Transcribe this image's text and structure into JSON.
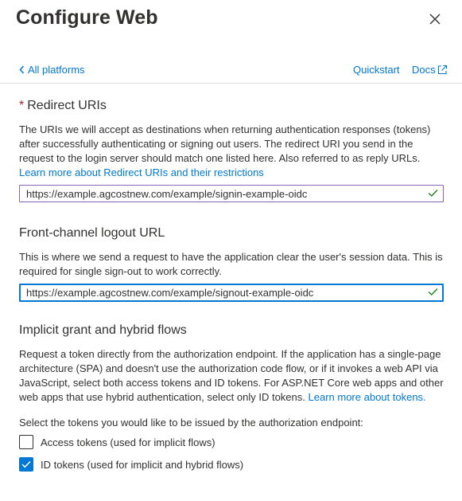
{
  "panel": {
    "title": "Configure Web",
    "close_icon": "close-icon"
  },
  "nav": {
    "back_label": "All platforms",
    "quickstart_label": "Quickstart",
    "docs_label": "Docs"
  },
  "redirect": {
    "required_marker": "*",
    "heading": "Redirect URIs",
    "description": "The URIs we will accept as destinations when returning authentication responses (tokens) after successfully authenticating or signing out users. The redirect URI you send in the request to the login server should match one listed here. Also referred to as reply URLs.",
    "learn_more": "Learn more about Redirect URIs and their restrictions",
    "uri_value": "https://example.agcostnew.com/example/signin-example-oidc"
  },
  "logout": {
    "heading": "Front-channel logout URL",
    "description": "This is where we send a request to have the application clear the user's session data. This is required for single sign-out to work correctly.",
    "url_value": "https://example.agcostnew.com/example/signout-example-oidc"
  },
  "implicit": {
    "heading": "Implicit grant and hybrid flows",
    "description": "Request a token directly from the authorization endpoint. If the application has a single-page architecture (SPA) and doesn't use the authorization code flow, or if it invokes a web API via JavaScript, select both access tokens and ID tokens. For ASP.NET Core web apps and other web apps that use hybrid authentication, select only ID tokens.",
    "learn_more": "Learn more about tokens.",
    "tokens_prompt": "Select the tokens you would like to be issued by the authorization endpoint:",
    "access_tokens_label": "Access tokens (used for implicit flows)",
    "access_tokens_checked": false,
    "id_tokens_label": "ID tokens (used for implicit and hybrid flows)",
    "id_tokens_checked": true
  },
  "colors": {
    "accent": "#0078d4",
    "required": "#a4262c",
    "valid_check": "#107c10",
    "input_purple": "#8764b8"
  }
}
